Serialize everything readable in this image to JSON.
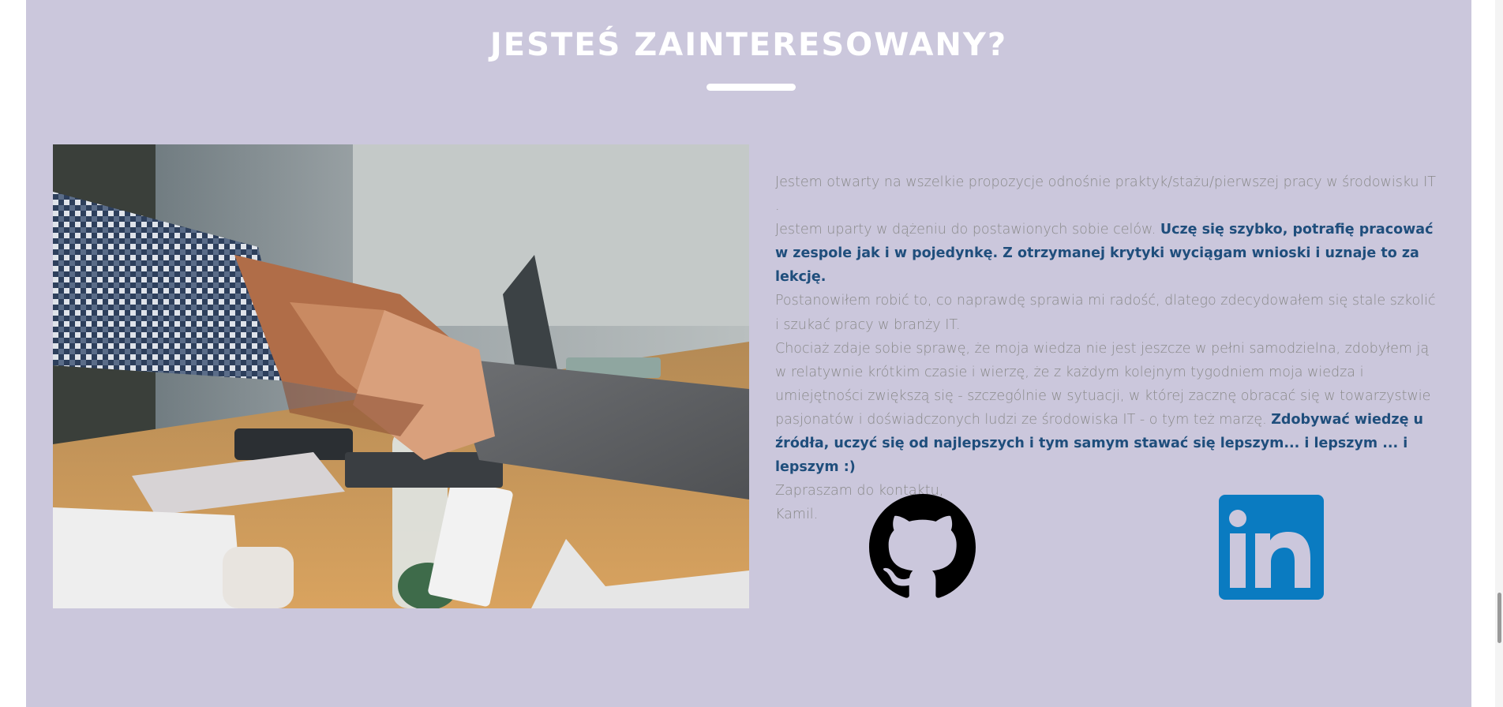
{
  "section": {
    "heading": "JESTEŚ ZAINTERESOWANY?",
    "background_color": "#cbc7dc",
    "accent_text_color": "#1f4e7c"
  },
  "photo": {
    "description_icon": "handshake-photo"
  },
  "about": {
    "p1": "Jestem otwarty na wszelkie propozycje odnośnie praktyk/stażu/pierwszej pracy w środowisku IT .",
    "p2_plain": "Jestem uparty w dążeniu do postawionych sobie celów. ",
    "p2_bold": "Uczę się szybko, potrafię pracować w zespole jak i w pojedynkę. Z otrzymanej krytyki wyciągam wnioski i uznaje to za lekcję.",
    "p3": "Postanowiłem robić to, co naprawdę sprawia mi radość, dlatego zdecydowałem się stale szkolić i szukać pracy w branży IT.",
    "p4_plain": "Chociaż zdaje sobie sprawę, że moja wiedza nie jest jeszcze w pełni samodzielna, zdobyłem ją w relatywnie krótkim czasie i wierzę, że z każdym kolejnym tygodniem moja wiedza i umiejętności zwiększą się - szczególnie w sytuacji, w której zacznę obracać się w towarzystwie pasjonatów i doświadczonych ludzi ze środowiska IT - o tym też marzę. ",
    "p4_bold": "Zdobywać wiedzę u źródła, uczyć się od najlepszych i tym samym stawać się lepszym... i lepszym ... i lepszym :)",
    "p5": "Zapraszam do kontaktu,",
    "p6": "Kamil."
  },
  "social": {
    "github_icon": "github-icon",
    "github_color": "#000000",
    "linkedin_icon": "linkedin-icon",
    "linkedin_color": "#0a7bc1"
  }
}
